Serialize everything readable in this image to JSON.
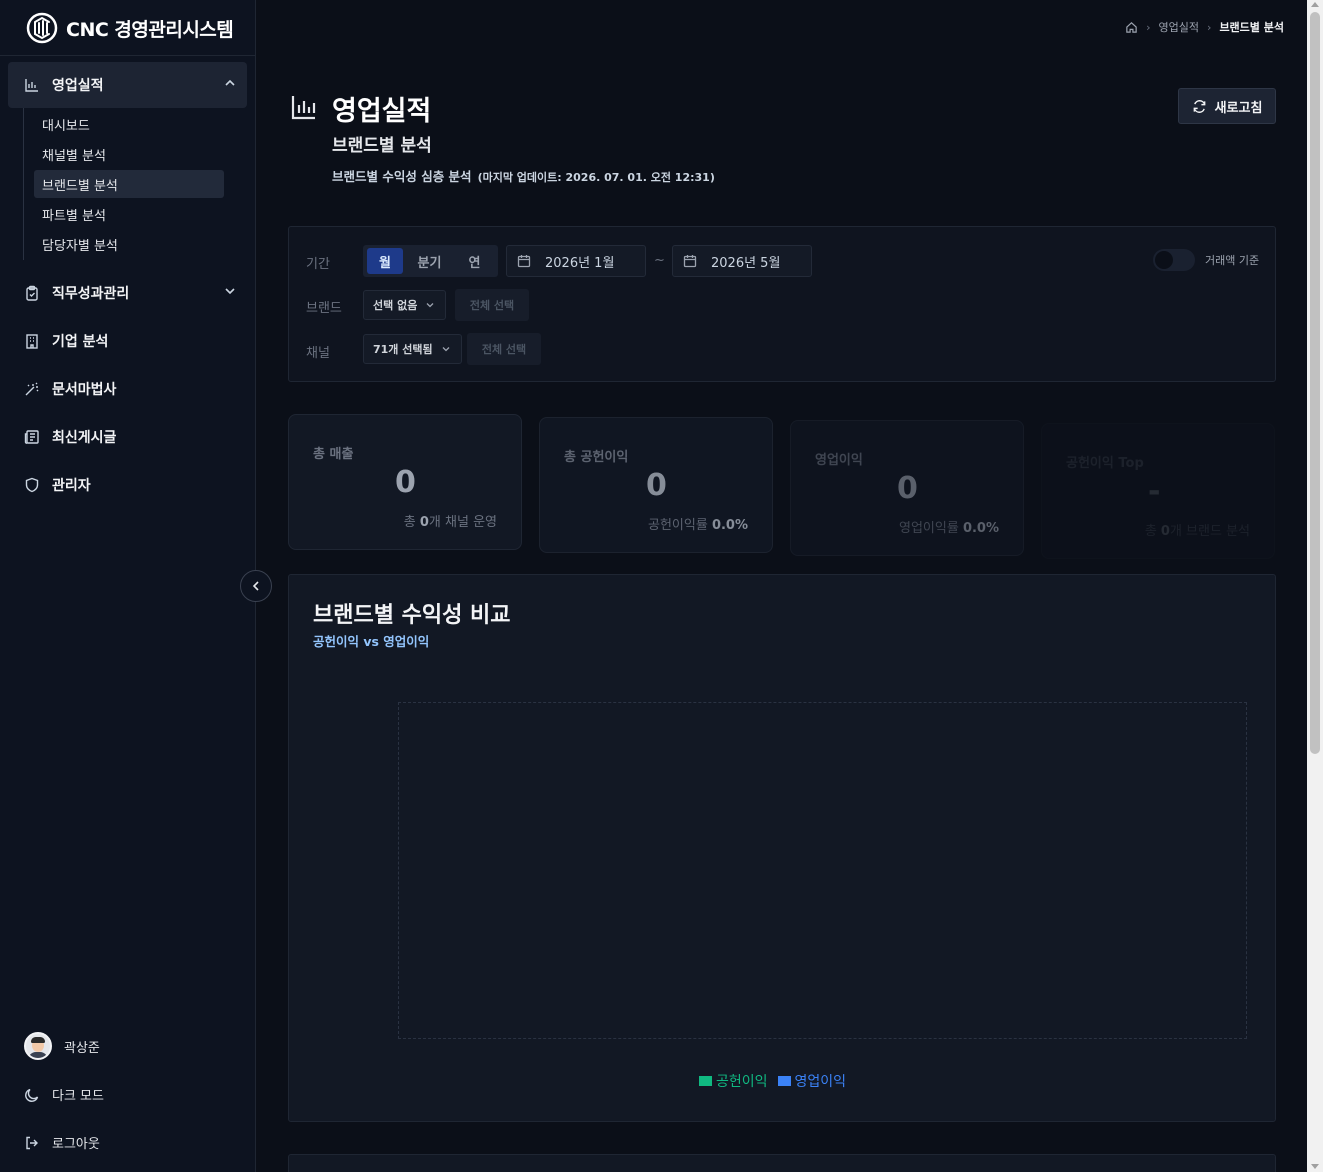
{
  "app": {
    "title": "CNC 경영관리시스템"
  },
  "sidebar": {
    "groups": [
      {
        "label": "영업실적",
        "icon": "bar-chart-icon",
        "expanded": true
      },
      {
        "label": "직무성과관리",
        "icon": "clipboard-icon",
        "expanded": false
      },
      {
        "label": "기업 분석",
        "icon": "building-icon"
      },
      {
        "label": "문서마법사",
        "icon": "magic-wand-icon"
      },
      {
        "label": "최신게시글",
        "icon": "newspaper-icon"
      },
      {
        "label": "관리자",
        "icon": "shield-icon"
      }
    ],
    "subitems": [
      "대시보드",
      "채널별 분석",
      "브랜드별 분석",
      "파트별 분석",
      "담당자별 분석"
    ],
    "active_subitem": "브랜드별 분석",
    "user": {
      "name": "곽상준"
    },
    "dark_mode_label": "다크 모드",
    "logout_label": "로그아웃"
  },
  "breadcrumb": {
    "items": [
      "영업실적",
      "브랜드별 분석"
    ]
  },
  "page": {
    "title": "영업실적",
    "subtitle": "브랜드별 분석",
    "description": "브랜드별 수익성 심층 분석",
    "last_updated": "(마지막 업데이트: 2026. 07. 01. 오전 12:31)",
    "refresh_label": "새로고침"
  },
  "filters": {
    "period_label": "기간",
    "period_options": [
      "월",
      "분기",
      "연"
    ],
    "period_selected": "월",
    "start_date": "2026년 1월",
    "range_sep": "~",
    "end_date": "2026년 5월",
    "toggle_label": "거래액 기준",
    "toggle_on": false,
    "brand_label": "브랜드",
    "brand_value": "선택 없음",
    "brand_select_all": "전체 선택",
    "channel_label": "채널",
    "channel_value": "71개 선택됨",
    "channel_select_all": "전체 선택"
  },
  "stats": [
    {
      "title": "총 매출",
      "value": "0",
      "sub_prefix": "총 ",
      "sub_num": "0",
      "sub_suffix": "개 채널 운영"
    },
    {
      "title": "총 공헌이익",
      "value": "0",
      "sub_prefix": "공헌이익률 ",
      "sub_num": "0.0%",
      "sub_suffix": ""
    },
    {
      "title": "영업이익",
      "value": "0",
      "sub_prefix": "영업이익률 ",
      "sub_num": "0.0%",
      "sub_suffix": ""
    },
    {
      "title": "공헌이익 Top",
      "value": "-",
      "sub_prefix": "총 ",
      "sub_num": "0",
      "sub_suffix": "개 브랜드 분석"
    }
  ],
  "chart": {
    "title": "브랜드별 수익성 비교",
    "subtitle": "공헌이익 vs 영업이익",
    "legend": [
      {
        "name": "공헌이익",
        "color": "#10b981"
      },
      {
        "name": "영업이익",
        "color": "#3b82f6"
      }
    ]
  },
  "chart_data": {
    "type": "bar",
    "title": "브랜드별 수익성 비교",
    "subtitle": "공헌이익 vs 영업이익",
    "categories": [],
    "series": [
      {
        "name": "공헌이익",
        "values": []
      },
      {
        "name": "영업이익",
        "values": []
      }
    ],
    "legend": "bottom-center",
    "grid": false
  }
}
